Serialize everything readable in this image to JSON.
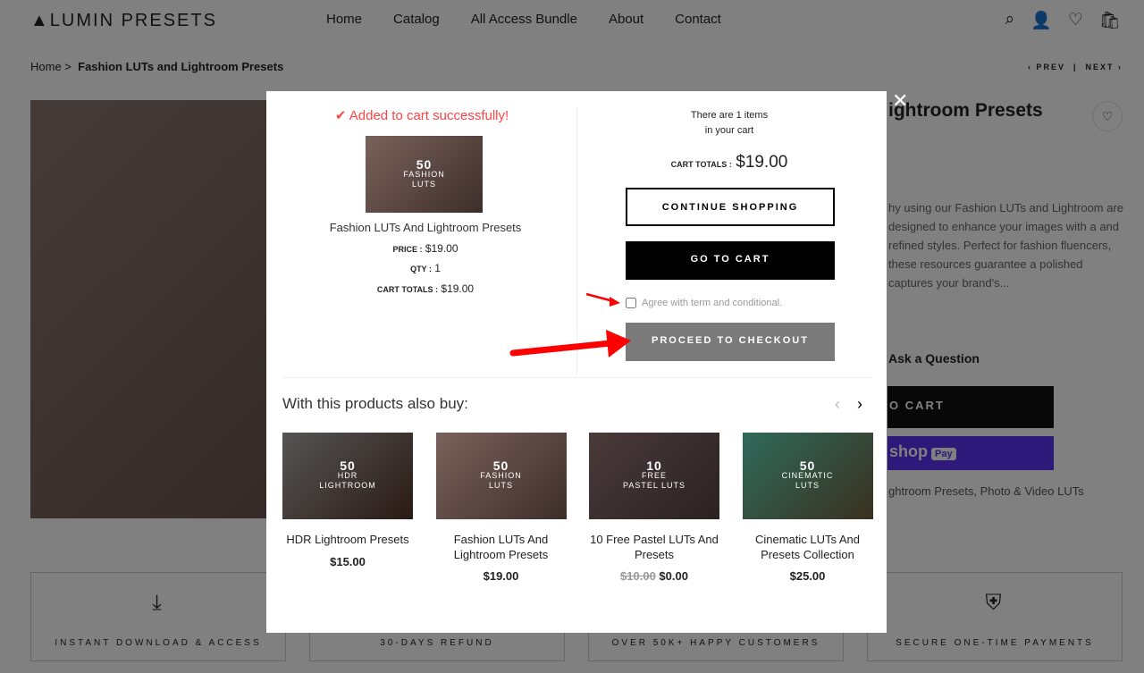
{
  "header": {
    "logo": "▲LUMIN PRESETS",
    "nav": [
      "Home",
      "Catalog",
      "All Access Bundle",
      "About",
      "Contact"
    ]
  },
  "breadcrumb": {
    "home": "Home",
    "current": "Fashion LUTs and Lightroom Presets"
  },
  "pager": {
    "prev": "‹ PREV",
    "next": "NEXT ›"
  },
  "product": {
    "title_visible": "ightroom Presets",
    "description": "hy using our Fashion LUTs and Lightroom are designed to enhance your images with a and refined styles. Perfect for fashion fluencers, these resources guarantee a polished captures your brand's...",
    "ask": "Ask a Question",
    "add_to_cart": "O CART",
    "shop_pay": "shop",
    "pay": "Pay",
    "categories": "ghtroom Presets, Photo & Video LUTs"
  },
  "features": [
    "INSTANT DOWNLOAD & ACCESS",
    "30-DAYS REFUND",
    "OVER 50K+ HAPPY CUSTOMERS",
    "SECURE ONE-TIME PAYMENTS"
  ],
  "modal": {
    "success": "Added to cart successfully!",
    "item": {
      "image_text": [
        "50",
        "FASHION",
        "LUTS"
      ],
      "name": "Fashion LUTs And Lightroom Presets",
      "price_label": "PRICE :",
      "price": "$19.00",
      "qty_label": "QTY :",
      "qty": "1",
      "totals_label": "CART TOTALS :",
      "totals": "$19.00"
    },
    "cart_count_line1": "There are 1 items",
    "cart_count_line2": "in your cart",
    "cart_totals_label": "CART TOTALS :",
    "cart_totals": "$19.00",
    "continue": "CONTINUE SHOPPING",
    "go_to_cart": "GO TO CART",
    "agree": "Agree with term and conditional.",
    "agree_checked": false,
    "checkout": "PROCEED TO CHECKOUT",
    "also_buy": "With this products also buy:",
    "products": [
      {
        "img": [
          "50",
          "HDR",
          "LIGHTROOM"
        ],
        "name": "HDR Lightroom Presets",
        "price": "$15.00",
        "old_price": ""
      },
      {
        "img": [
          "50",
          "FASHION",
          "LUTS"
        ],
        "name": "Fashion LUTs And Lightroom Presets",
        "price": "$19.00",
        "old_price": ""
      },
      {
        "img": [
          "10",
          "FREE",
          "PASTEL LUTS"
        ],
        "name": "10 Free Pastel LUTs And Presets",
        "price": "$0.00",
        "old_price": "$10.00"
      },
      {
        "img": [
          "50",
          "CINEMATIC",
          "LUTS"
        ],
        "name": "Cinematic LUTs And Presets Collection",
        "price": "$25.00",
        "old_price": ""
      }
    ]
  },
  "colors": {
    "success": "#ff4444",
    "arrow": "#ff0000",
    "checkout_bg": "#7a7a7a",
    "shop_pay": "#5a31f4"
  }
}
